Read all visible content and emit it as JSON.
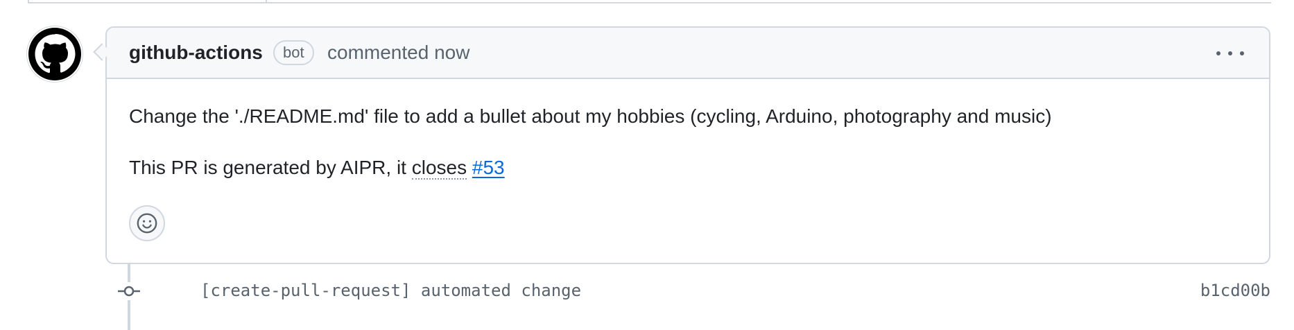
{
  "comment": {
    "author": "github-actions",
    "badge": "bot",
    "timestamp": "commented now",
    "body_line1": "Change the './README.md' file to add a bullet about my hobbies (cycling, Arduino, photography and music)",
    "body_line2_prefix": "This PR is generated by AIPR, it ",
    "body_line2_closes": "closes",
    "body_line2_space": " ",
    "issue_link": "#53"
  },
  "icons": {
    "avatar": "github-octocat-icon",
    "menu": "kebab-horizontal-icon",
    "reaction": "smiley-icon",
    "commit": "git-commit-icon"
  },
  "commit": {
    "message": "[create-pull-request] automated change",
    "sha": "b1cd00b"
  },
  "colors": {
    "link": "#0969da",
    "muted": "#59636e",
    "border": "#d0d7de",
    "header_bg": "#f6f8fa"
  }
}
